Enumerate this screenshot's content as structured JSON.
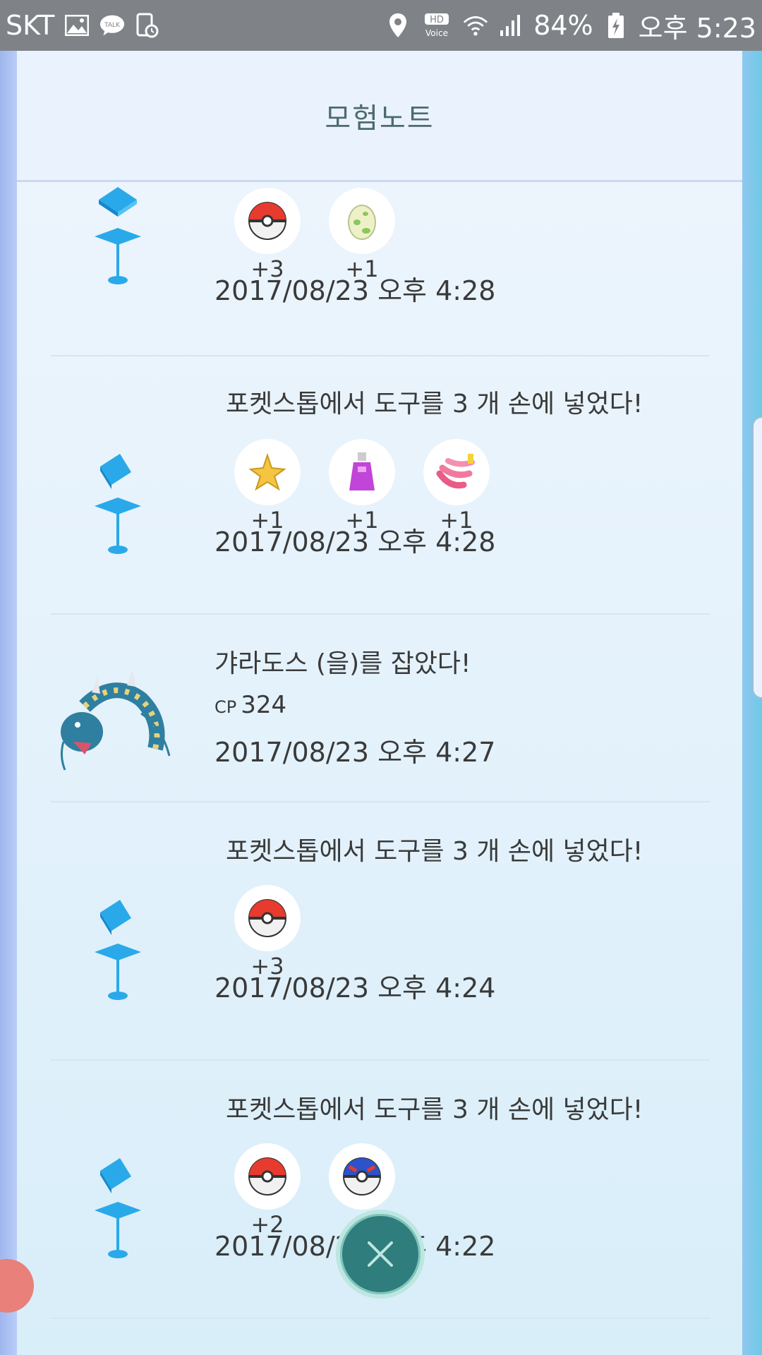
{
  "status_bar": {
    "carrier": "SKT",
    "talk_label": "TALK",
    "hd_label": "HD",
    "voice_label": "Voice",
    "battery": "84%",
    "time": "오후 5:23"
  },
  "header": {
    "title": "모험노트"
  },
  "entries": [
    {
      "type": "pokestop",
      "items": [
        {
          "icon": "pokeball-icon",
          "count": "+3"
        },
        {
          "icon": "egg-icon",
          "count": "+1"
        }
      ],
      "date": "2017/08/23 오후 4:28"
    },
    {
      "type": "pokestop",
      "text": "포켓스톱에서 도구를 3 개 손에 넣었다!",
      "items": [
        {
          "icon": "stardust-icon",
          "count": "+1"
        },
        {
          "icon": "potion-icon",
          "count": "+1"
        },
        {
          "icon": "nanab-berry-icon",
          "count": "+1"
        }
      ],
      "date": "2017/08/23 오후 4:28"
    },
    {
      "type": "catch",
      "text": "갸라도스 (을)를 잡았다!",
      "cp_label": "CP",
      "cp_value": "324",
      "date": "2017/08/23 오후 4:27"
    },
    {
      "type": "pokestop",
      "text": "포켓스톱에서 도구를 3 개 손에 넣었다!",
      "items": [
        {
          "icon": "pokeball-icon",
          "count": "+3"
        }
      ],
      "date": "2017/08/23 오후 4:24"
    },
    {
      "type": "pokestop",
      "text": "포켓스톱에서 도구를 3 개 손에 넣었다!",
      "items": [
        {
          "icon": "pokeball-icon",
          "count": "+2"
        },
        {
          "icon": "greatball-icon",
          "count": ""
        }
      ],
      "date": "2017/08/23 오후 4:22"
    }
  ],
  "colors": {
    "text": "#3a3a3a",
    "header_title": "#4d6a6f",
    "pokestop_blue": "#2aa9ea",
    "fab": "#2f7d7c"
  }
}
